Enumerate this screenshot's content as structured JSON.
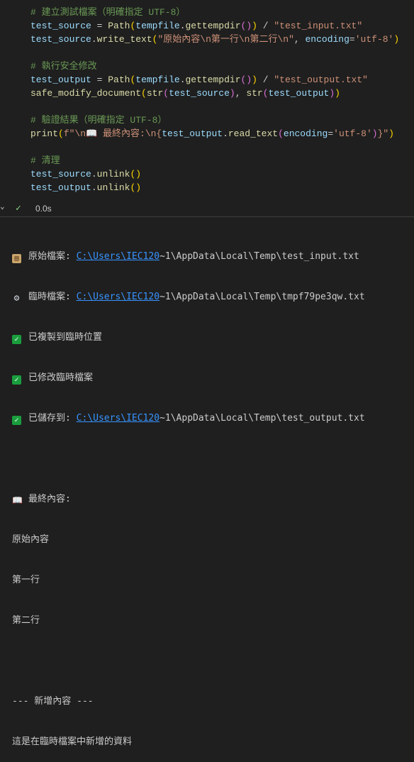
{
  "code": {
    "c1": "# 建立測試檔案（明確指定 UTF-8）",
    "l2": {
      "v1": "test_source",
      "eq": " = ",
      "cls": "Path",
      "p1": "(",
      "v2": "tempfile",
      "dot": ".",
      "fn": "gettempdir",
      "p2": "()",
      "p3": ")",
      "op": " / ",
      "str": "\"test_input.txt\""
    },
    "l3": {
      "v1": "test_source",
      "dot": ".",
      "fn": "write_text",
      "p1": "(",
      "str": "\"原始內容\\n第一行\\n第二行\\n\"",
      "comma": ", ",
      "kw": "encoding",
      "eq": "=",
      "str2": "'utf-8'",
      "p2": ")"
    },
    "c2": "# 執行安全修改",
    "l5": {
      "v1": "test_output",
      "eq": " = ",
      "cls": "Path",
      "p1": "(",
      "v2": "tempfile",
      "dot": ".",
      "fn": "gettempdir",
      "p2": "()",
      "p3": ")",
      "op": " / ",
      "str": "\"test_output.txt\""
    },
    "l6": {
      "fn": "safe_modify_document",
      "p1": "(",
      "fn2": "str",
      "p2": "(",
      "v1": "test_source",
      "p3": ")",
      "comma": ", ",
      "fn3": "str",
      "p4": "(",
      "v2": "test_output",
      "p5": ")",
      "p6": ")"
    },
    "c3": "# 驗證結果（明確指定 UTF-8）",
    "l8": {
      "fn": "print",
      "p1": "(",
      "pre": "f\"\\n📖 最終內容:\\n{",
      "v1": "test_output",
      "dot": ".",
      "fn2": "read_text",
      "p2": "(",
      "kw": "encoding",
      "eq": "=",
      "str2": "'utf-8'",
      "p3": ")",
      "post": "}\"",
      "p4": ")"
    },
    "c4": "# 清理",
    "l10": {
      "v1": "test_source",
      "dot": ".",
      "fn": "unlink",
      "p": "()"
    },
    "l11": {
      "v1": "test_output",
      "dot": ".",
      "fn": "unlink",
      "p": "()"
    }
  },
  "status": {
    "duration": "0.0s"
  },
  "output": {
    "r1": {
      "label": "原始檔案: ",
      "link": "C:\\Users\\IEC120",
      "rest": "~1\\AppData\\Local\\Temp\\test_input.txt"
    },
    "r2": {
      "label": "臨時檔案: ",
      "link": "C:\\Users\\IEC120",
      "rest": "~1\\AppData\\Local\\Temp\\tmpf79pe3qw.txt"
    },
    "r3": "已複製到臨時位置",
    "r4": "已修改臨時檔案",
    "r5": {
      "label": "已儲存到: ",
      "link": "C:\\Users\\IEC120",
      "rest": "~1\\AppData\\Local\\Temp\\test_output.txt"
    },
    "final_label": "最終內容:",
    "t1": "原始內容",
    "t2": "第一行",
    "t3": "第二行",
    "added_header": "--- 新增內容 ---",
    "added_text": "這是在臨時檔案中新增的資料"
  },
  "icons": {
    "clipboard": "clipboard-icon",
    "gear": "gear-icon",
    "check": "check-mark-icon",
    "book": "open-book-icon"
  }
}
